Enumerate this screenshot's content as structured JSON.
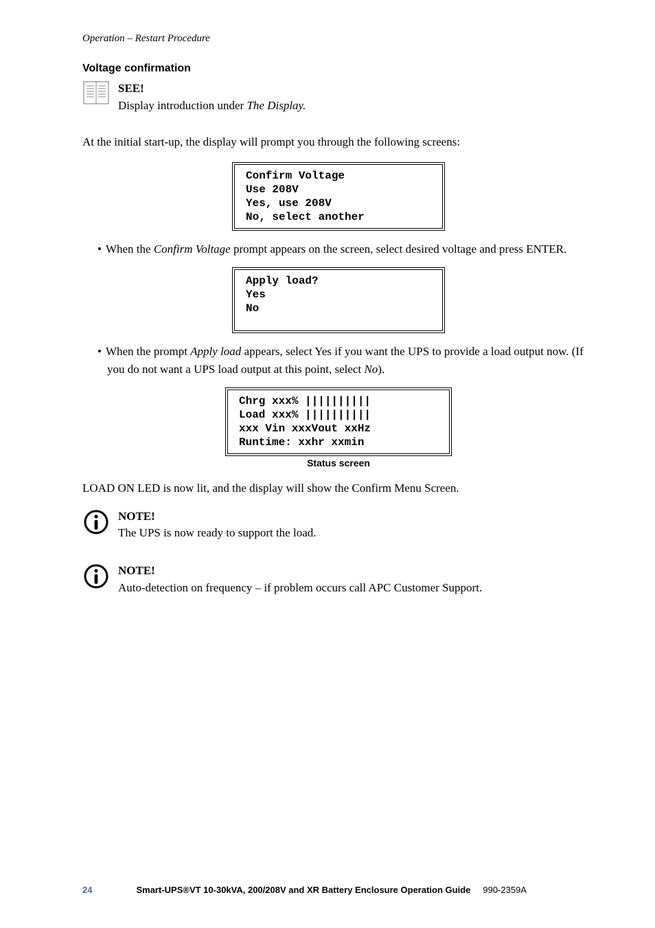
{
  "running_head": "Operation – Restart Procedure",
  "subsection": "Voltage confirmation",
  "see": {
    "label": "SEE!",
    "text_a": "Display introduction under ",
    "text_b": "The Display."
  },
  "para_intro": "At the initial start-up, the display will prompt you through the following screens:",
  "screen1": {
    "l1": "Confirm Voltage",
    "l2": "Use 208V",
    "l3": "Yes, use 208V",
    "l4": "No, select another"
  },
  "bullet1": {
    "a": "When the ",
    "b": "Confirm Voltage",
    "c": " prompt appears on the screen, select desired voltage and press ENTER."
  },
  "screen2": {
    "l1": "Apply load?",
    "l2": "Yes",
    "l3": "No"
  },
  "bullet2": {
    "a": "When the prompt ",
    "b": "Apply load",
    "c": " appears, select Yes if you want the UPS to provide a load output now. (If you do not want a UPS load output at this point, select ",
    "d": "No",
    "e": ")."
  },
  "screen3": {
    "l1": "Chrg xxx% ||||||||||",
    "l2": "Load xxx% ||||||||||",
    "l3": "xxx Vin xxxVout xxHz",
    "l4": "Runtime: xxhr xxmin"
  },
  "screen3_caption": "Status screen",
  "para_load": "LOAD ON LED is now lit, and the display will show the Confirm Menu Screen.",
  "note1": {
    "label": "NOTE!",
    "text": "The UPS is now ready to support the load."
  },
  "note2": {
    "label": "NOTE!",
    "text": "Auto-detection on frequency – if problem occurs call APC Customer Support."
  },
  "footer": {
    "page": "24",
    "title": "Smart-UPS®VT 10-30kVA, 200/208V and XR Battery Enclosure Operation Guide",
    "docnum": "990-2359A"
  }
}
